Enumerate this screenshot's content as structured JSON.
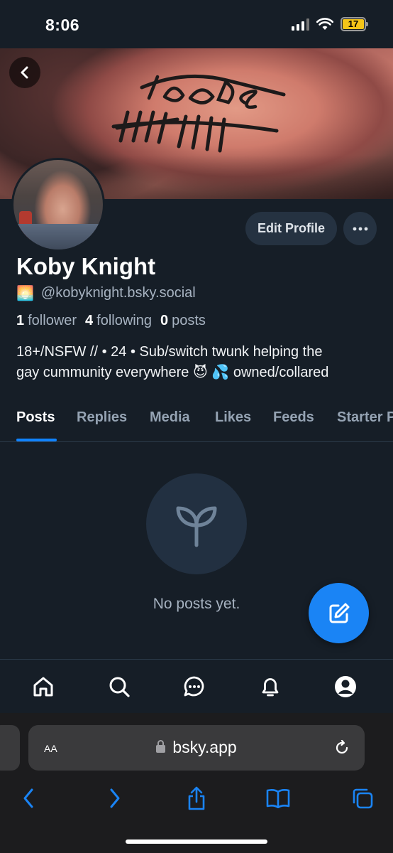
{
  "status_bar": {
    "time": "8:06",
    "battery": "17",
    "battery_color": "#f5c518"
  },
  "profile": {
    "display_name": "Koby Knight",
    "handle_emoji": "🌅",
    "handle": "@kobyknight.bsky.social",
    "edit_label": "Edit Profile",
    "more_label": "···",
    "stats": {
      "followers_count": "1",
      "followers_label": "follower",
      "following_count": "4",
      "following_label": "following",
      "posts_count": "0",
      "posts_label": "posts"
    },
    "bio_lines": [
      "18+/NSFW // • 24 • Sub/switch twunk helping the",
      "gay cummunity everywhere 😈 💦 owned/collared"
    ]
  },
  "tabs": [
    "Posts",
    "Replies",
    "Media",
    "Likes",
    "Feeds",
    "Starter P"
  ],
  "active_tab": "Posts",
  "empty_state": {
    "icon": "seedling-icon",
    "text": "No posts yet."
  },
  "fab": {
    "icon": "compose-icon",
    "color": "#1a84f5"
  },
  "bottom_nav": [
    "home-icon",
    "search-icon",
    "chat-icon",
    "bell-icon",
    "profile-icon"
  ],
  "browser": {
    "text_size_label": "AA",
    "url": "bsky.app",
    "toolbar": [
      "back-icon",
      "forward-icon",
      "share-icon",
      "bookmarks-icon",
      "tabs-icon"
    ]
  },
  "colors": {
    "background": "#161e27",
    "accent": "#1083fe",
    "muted_text": "#a7b3c1"
  }
}
